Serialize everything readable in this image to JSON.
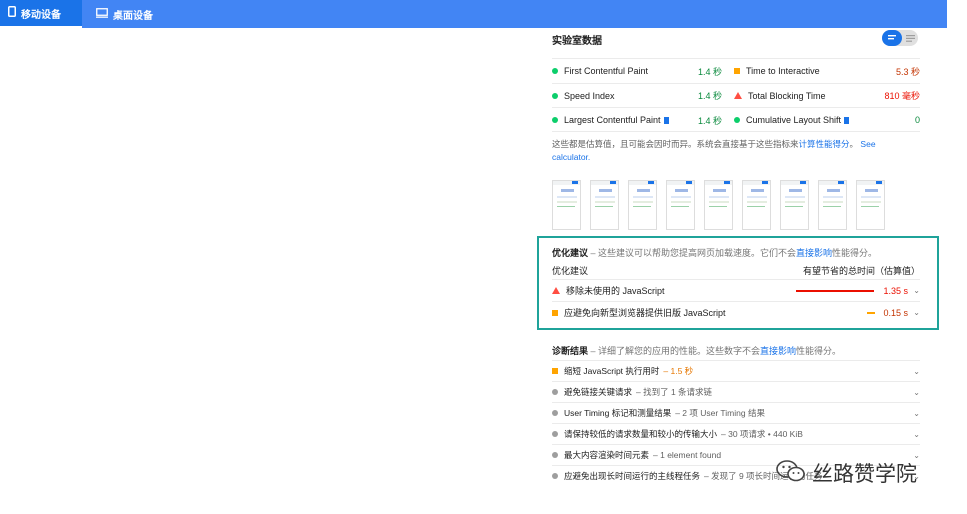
{
  "tabs": [
    {
      "label": "移动设备",
      "icon": "phone-icon",
      "active": true
    },
    {
      "label": "桌面设备",
      "icon": "desktop-icon",
      "active": false
    }
  ],
  "lab": {
    "title": "实验室数据",
    "metrics": [
      {
        "name": "First Contentful Paint",
        "value": "1.4 秒",
        "status": "good",
        "col": 0
      },
      {
        "name": "Time to Interactive",
        "value": "5.3 秒",
        "status": "average",
        "col": 1
      },
      {
        "name": "Speed Index",
        "value": "1.4 秒",
        "status": "good",
        "col": 0
      },
      {
        "name": "Total Blocking Time",
        "value": "810 毫秒",
        "status": "poor",
        "col": 1
      },
      {
        "name": "Largest Contentful Paint",
        "value": "1.4 秒",
        "status": "good",
        "col": 0
      },
      {
        "name": "Cumulative Layout Shift",
        "value": "0",
        "status": "good",
        "col": 1
      }
    ],
    "note_prefix": "这些都是估算值，且可能会因时而异。系统会直接基于这些指标来",
    "note_link1": "计算性能得分",
    "note_mid": "。",
    "note_link2": "See calculator.",
    "colors": {
      "good": "#0cce6b",
      "average": "#ffa400",
      "poor": "#ff4e42",
      "link": "#1a73e8"
    }
  },
  "opportunities": {
    "title": "优化建议",
    "desc_prefix": " – 这些建议可以帮助您提高网页加载速度。它们不会",
    "desc_link": "直接影响",
    "desc_suffix": "性能得分。",
    "col_left": "优化建议",
    "col_right": "有望节省的总时间（估算值）",
    "items": [
      {
        "label": "移除未使用的 JavaScript",
        "value": "1.35 s",
        "status": "poor"
      },
      {
        "label": "应避免向新型浏览器提供旧版 JavaScript",
        "value": "0.15 s",
        "status": "average"
      }
    ],
    "box_color": "#1fa39a"
  },
  "diagnostics": {
    "title": "诊断结果",
    "desc_prefix": " – 详细了解您的应用的性能。这些数字不会",
    "desc_link": "直接影响",
    "desc_suffix": "性能得分。",
    "items": [
      {
        "label": "缩短 JavaScript 执行用时",
        "desc": " – 1.5 秒",
        "status": "average"
      },
      {
        "label": "避免链接关键请求",
        "desc": " – 找到了 1 条请求链",
        "status": "info"
      },
      {
        "label": "User Timing 标记和测量结果",
        "desc": " – 2 项 User Timing 结果",
        "status": "info"
      },
      {
        "label": "请保持较低的请求数量和较小的传输大小",
        "desc": " – 30 项请求 • 440 KiB",
        "status": "info"
      },
      {
        "label": "最大内容渲染时间元素",
        "desc": " – 1 element found",
        "status": "info"
      },
      {
        "label": "应避免出现长时间运行的主线程任务",
        "desc": " – 发现了 9 项长时间运行的任务",
        "status": "info"
      }
    ]
  },
  "watermark": {
    "text": "丝路赞学院",
    "icon": "wechat-icon"
  }
}
